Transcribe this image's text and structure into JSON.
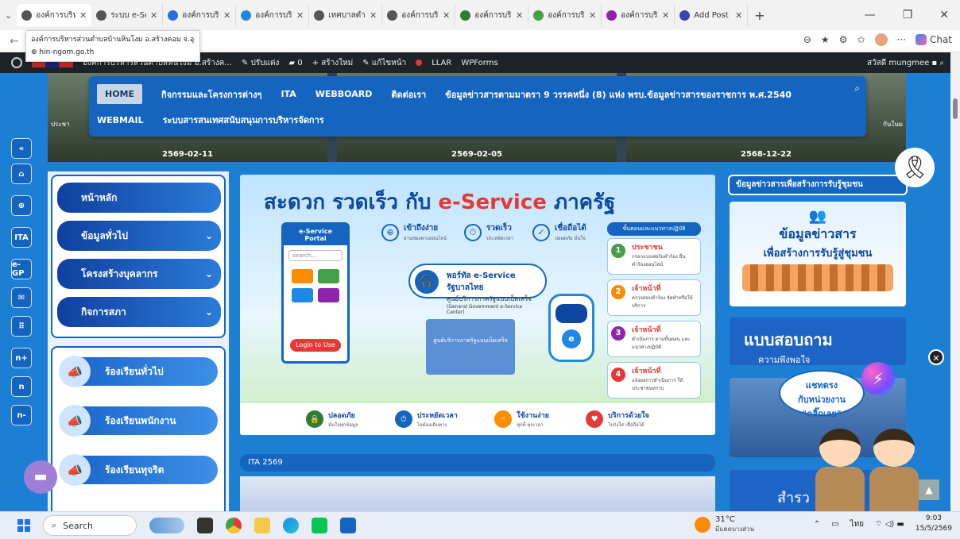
{
  "browser": {
    "tabs": [
      {
        "label": "องค์การบริหาร",
        "active": true,
        "favcolor": "#555"
      },
      {
        "label": "ระบบ e-Servic",
        "favcolor": "#555"
      },
      {
        "label": "องค์การบริหาร",
        "favcolor": "#2a6fdb"
      },
      {
        "label": "องค์การบริหาร",
        "favcolor": "#1e88e5"
      },
      {
        "label": "เทศบาลตำบลหิ",
        "favcolor": "#555"
      },
      {
        "label": "องค์การบริหาร",
        "favcolor": "#555"
      },
      {
        "label": "องค์การบริหาร",
        "favcolor": "#2e7d32"
      },
      {
        "label": "องค์การบริหาร",
        "favcolor": "#43a047"
      },
      {
        "label": "องค์การบริหาร",
        "favcolor": "#8e24aa"
      },
      {
        "label": "Add Post ‹ แม",
        "favcolor": "#3949ab"
      }
    ],
    "tooltip_title": "องค์การบริหารส่วนตำบลบ้านหินโงม อ.สร้างคอม จ.อุดรธานี",
    "tooltip_url": "hin-ngom.go.th",
    "chat_label": "Chat"
  },
  "wpbar": {
    "site": "องค์การบริหารส่วนตำบลหินโงม อ.สร้างค...",
    "customize": "ปรับแต่ง",
    "comments": "0",
    "new": "สร้างใหม่",
    "edit": "แก้ไขหน้า",
    "llar": "LLAR",
    "wpforms": "WPForms",
    "greeting": "สวัสดี mungmee"
  },
  "menu": {
    "row1": [
      "HOME",
      "กิจกรรมและโครงการต่างๆ",
      "ITA",
      "WEBBOARD",
      "ติดต่อเรา",
      "ข้อมูลข่าวสารตามมาตรา 9 วรรคหนึ่ง (8) แห่ง พรบ.ข้อมูลข่าวสารของราชการ พ.ศ.2540"
    ],
    "row2": [
      "WEBMAIL",
      "ระบบสารสนเทศสนับสนุนการบริหารจัดการ"
    ]
  },
  "news": [
    {
      "date": "2569-02-11",
      "snippet": "ประชา"
    },
    {
      "date": "2569-02-05"
    },
    {
      "date": "2568-12-22",
      "snippet": "กันในม"
    }
  ],
  "sidebar_buttons": [
    "«",
    "⌂",
    "⊕",
    "ITA",
    "e-GP",
    "✉",
    "⠿",
    "n+",
    "n",
    "n-"
  ],
  "nav": [
    {
      "label": "หน้าหลัก",
      "chevron": false
    },
    {
      "label": "ข้อมูลทั่วไป",
      "chevron": true
    },
    {
      "label": "โครงสร้างบุคลากร",
      "chevron": true
    },
    {
      "label": "กิจการสภา",
      "chevron": true
    }
  ],
  "complaints": [
    "ร้องเรียนทั่วไป",
    "ร้องเรียนพนักงาน",
    "ร้องเรียนทุจริต"
  ],
  "banner": {
    "title_pre": "สะดวก รวดเร็ว กับ ",
    "title_es": "e-Service",
    "title_post": " ภาครัฐ",
    "features": [
      {
        "t": "เข้าถึงง่าย",
        "s": "ผ่านช่องทางออนไลน์"
      },
      {
        "t": "รวดเร็ว",
        "s": "ประหยัดเวลา"
      },
      {
        "t": "เชื่อถือได้",
        "s": "ปลอดภัย มั่นใจ"
      }
    ],
    "portal_title": "e-Service Portal",
    "portal_search": "search...",
    "portal_login": "Login to Use",
    "center_title": "พอร์ทัล e-Service รัฐบาลไทย",
    "center_sub": "ศูนย์บริการภาครัฐแบบเบ็ดเสร็จ",
    "center_en": "(General Government e-Service Center)",
    "gov_label": "ศูนย์บริการภาครัฐแบบเบ็ดเสร็จ",
    "steps_header": "ขั้นตอนและแนวทางปฏิบัติ",
    "steps": [
      {
        "n": "1",
        "t": "ประชาชน",
        "d": "กรอกแบบฟอร์มคำร้อง ยื่นคำร้องออนไลน์",
        "c": "#43a047"
      },
      {
        "n": "2",
        "t": "เจ้าหน้าที่",
        "d": "ตรวจสอบคำร้อง จัดทำหรือให้บริการ",
        "c": "#fb8c00"
      },
      {
        "n": "3",
        "t": "เจ้าหน้าที่",
        "d": "ดำเนินการ ตามขั้นตอน และแนวทางปฏิบัติ",
        "c": "#8e24aa"
      },
      {
        "n": "4",
        "t": "เจ้าหน้าที่",
        "d": "แจ้งผลการดำเนินการ ให้ประชาชนทราบ",
        "c": "#e53935"
      }
    ],
    "bottom": [
      {
        "t": "ปลอดภัย",
        "s": "มั่นใจทุกข้อมูล",
        "c": "#2e7d32",
        "i": "🔒"
      },
      {
        "t": "ประหยัดเวลา",
        "s": "ไม่ต้องเดินทาง",
        "c": "#1565c0",
        "i": "⏱"
      },
      {
        "t": "ใช้งานง่าย",
        "s": "ทุกที่ ทุกเวลา",
        "c": "#fb8c00",
        "i": "☝"
      },
      {
        "t": "บริการด้วยใจ",
        "s": "โปร่งใส เชื่อถือได้",
        "c": "#e53935",
        "i": "♥"
      }
    ]
  },
  "ita_label": "ITA 2569",
  "right": {
    "header": "ข้อมูลข่าวสารเพื่อสร้างการรับรู้ชุมชน",
    "info_l1": "ข้อมูลข่าวสาร",
    "info_l2": "เพื่อสร้างการรับรู้สู่ชุมชน",
    "survey_l1": "แบบสอบถาม",
    "survey_l2": "ความพึงพอใจ",
    "img2_text": "สำรว"
  },
  "chatbubble": [
    "แชทตรง",
    "กับหน่วยงาน",
    "\"คลิ๊กเลย\""
  ],
  "taskbar": {
    "search": "Search",
    "temp": "31°C",
    "weather": "มีแดดบางส่วน",
    "lang": "ไทย",
    "time": "9:03",
    "date": "15/5/2569"
  }
}
